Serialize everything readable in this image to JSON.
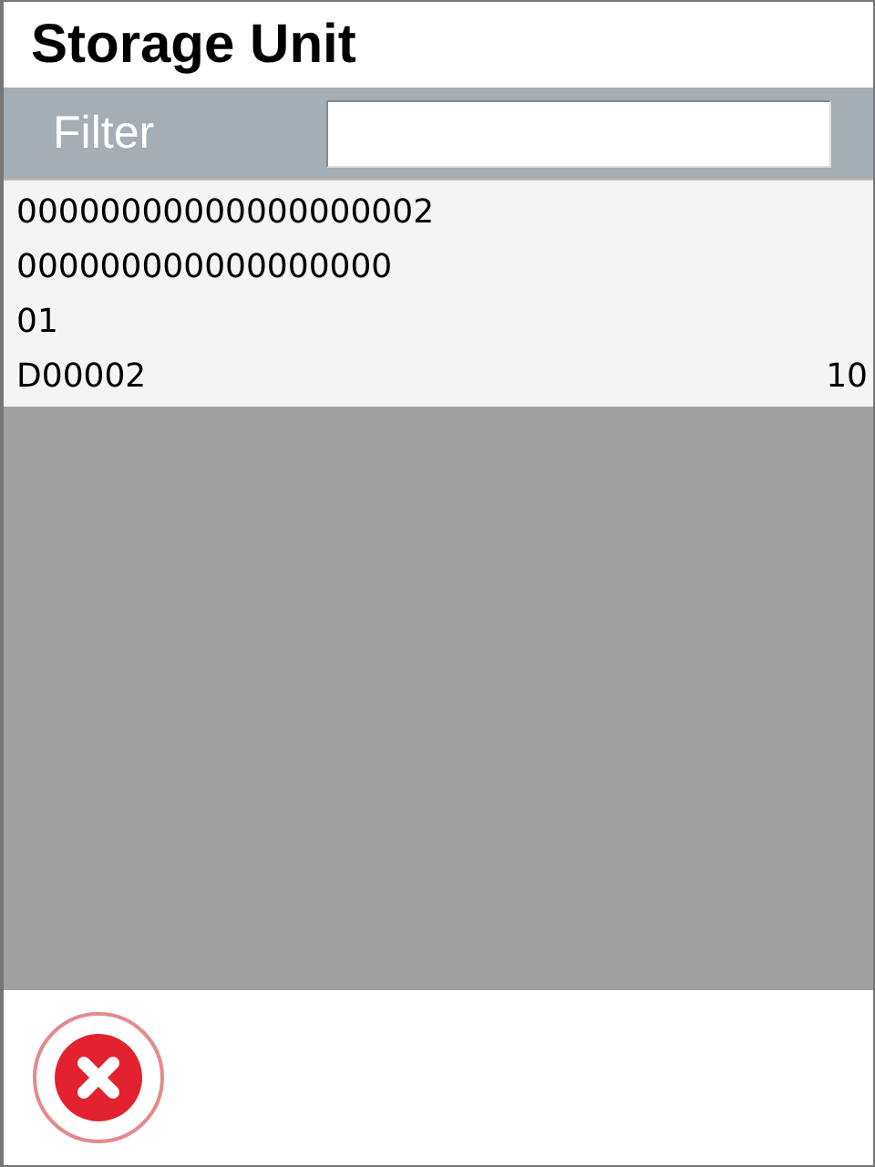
{
  "window": {
    "title": "Storage Unit"
  },
  "filter": {
    "label": "Filter"
  },
  "items": [
    {
      "lines": [
        "00000000000000000002",
        "000000000000000000",
        "01",
        "D00002"
      ],
      "quantity": "10"
    }
  ],
  "footer": {
    "buttons": [
      {
        "kind": "cancel"
      }
    ]
  }
}
